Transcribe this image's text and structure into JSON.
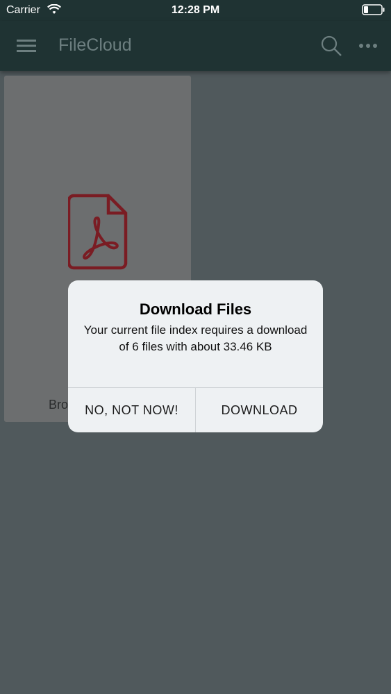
{
  "status_bar": {
    "carrier": "Carrier",
    "time": "12:28 PM"
  },
  "app_bar": {
    "title": "FileCloud",
    "icons": [
      "menu-icon",
      "search-icon",
      "more-icon"
    ]
  },
  "file_card": {
    "icon": "pdf-icon",
    "label_partial": "Bro"
  },
  "dialog": {
    "title": "Download Files",
    "message": "Your current file index requires a download of 6 files with about 33.46 KB",
    "cancel_label": "NO, NOT NOW!",
    "confirm_label": "DOWNLOAD"
  },
  "colors": {
    "app_bar": "#1f3333",
    "pdf_accent": "#7a1c23",
    "dialog_bg": "#eef1f3"
  }
}
